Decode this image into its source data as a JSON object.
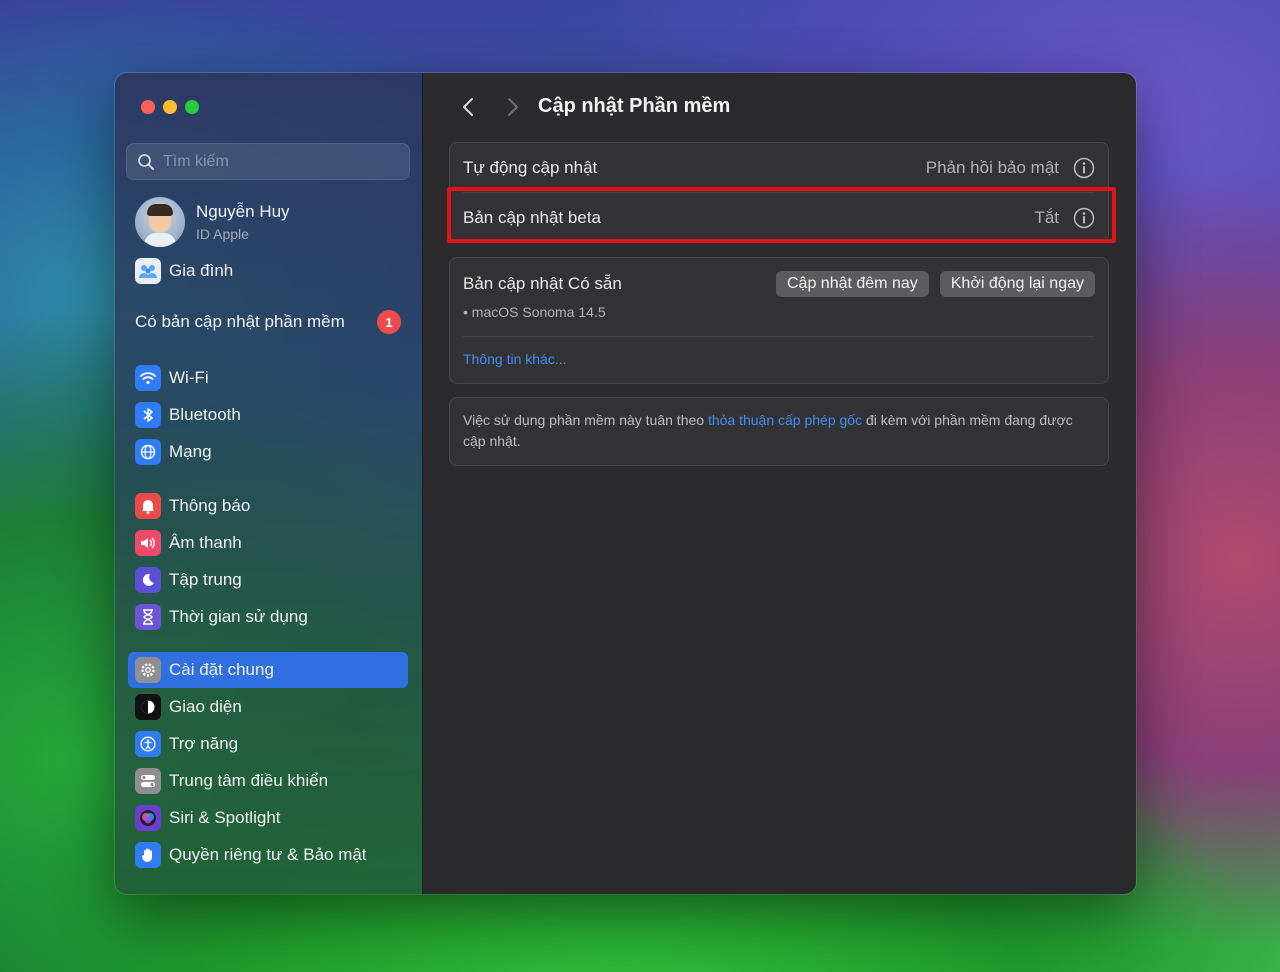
{
  "sidebar": {
    "search_placeholder": "Tìm kiếm",
    "profile": {
      "name": "Nguyễn Huy",
      "subtitle": "ID Apple"
    },
    "family": "Gia đình",
    "update_notice": {
      "label": "Có bản cập nhật phần mềm",
      "count": "1"
    },
    "items": [
      {
        "label": "Wi-Fi",
        "icon": "wifi-icon",
        "color": "#2f7cf6"
      },
      {
        "label": "Bluetooth",
        "icon": "bluetooth-icon",
        "color": "#2f7cf6"
      },
      {
        "label": "Mạng",
        "icon": "globe-icon",
        "color": "#2f7cf6"
      },
      {
        "label": "Thông báo",
        "icon": "bell-icon",
        "color": "#ef4a4a"
      },
      {
        "label": "Âm thanh",
        "icon": "speaker-icon",
        "color": "#ef4a6a"
      },
      {
        "label": "Tập trung",
        "icon": "moon-icon",
        "color": "#5b4fd8"
      },
      {
        "label": "Thời gian sử dụng",
        "icon": "hourglass-icon",
        "color": "#6d55d8"
      },
      {
        "label": "Cài đặt chung",
        "icon": "gear-icon",
        "color": "#8e8e93"
      },
      {
        "label": "Giao diện",
        "icon": "appearance-icon",
        "color": "#111111"
      },
      {
        "label": "Trợ năng",
        "icon": "accessibility-icon",
        "color": "#2f7cf6"
      },
      {
        "label": "Trung tâm điều khiển",
        "icon": "control-center-icon",
        "color": "#8e8e93"
      },
      {
        "label": "Siri & Spotlight",
        "icon": "siri-icon",
        "color": "#6b3fd0"
      },
      {
        "label": "Quyền riêng tư & Bảo mật",
        "icon": "hand-icon",
        "color": "#2f7cf6"
      }
    ]
  },
  "main": {
    "title": "Cập nhật Phần mềm",
    "auto_update": {
      "label": "Tự động cập nhật",
      "value": "Phản hồi bảo mật"
    },
    "beta": {
      "label": "Bản cập nhật beta",
      "value": "Tắt"
    },
    "available": {
      "label": "Bản cập nhật Có sẵn",
      "update_tonight": "Cập nhật đêm nay",
      "restart_now": "Khởi động lại ngay",
      "version": "• macOS Sonoma 14.5",
      "more_info": "Thông tin khác..."
    },
    "license": {
      "before": "Việc sử dụng phần mềm này tuân theo ",
      "link": "thỏa thuận cấp phép gốc",
      "after": " đi kèm với phần mềm đang được cập nhật."
    },
    "help": "?"
  }
}
